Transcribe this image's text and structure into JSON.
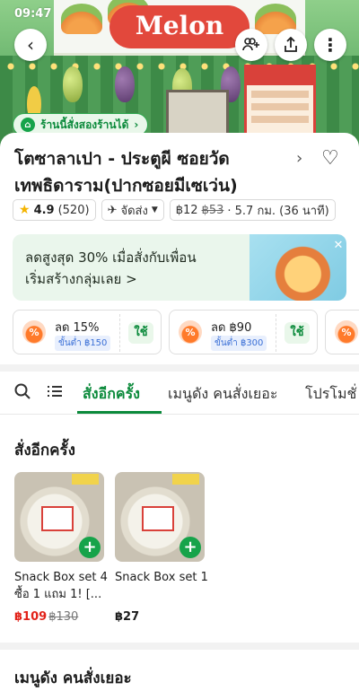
{
  "status_bar": {
    "time": "09:47"
  },
  "banner": {
    "logo_text": "Melon"
  },
  "tag": {
    "label": "ร้านนี้สั่งสองร้านได้"
  },
  "store": {
    "name": "โตซาลาเปา - ประตูผี ซอยวัดเทพธิดาราม(ปากซอยมีเซเว่น)",
    "rating": "4.9",
    "rating_count": "(520)",
    "delivery_label": "จัดส่ง",
    "price_now": "฿12",
    "price_old": "฿53",
    "distance": "· 5.7 กม. (36 นาที)"
  },
  "promo": {
    "line1": "ลดสูงสุด 30% เมื่อสั่งกับเพื่อน",
    "line2": "เริ่มสร้างกลุ่มเลย >"
  },
  "coupons": [
    {
      "title": "ลด 15%",
      "min": "ขั้นต่ำ ฿150",
      "use": "ใช้"
    },
    {
      "title": "ลด ฿90",
      "min": "ขั้นต่ำ ฿300",
      "use": "ใช้"
    }
  ],
  "tabs": [
    "สั่งอีกครั้ง",
    "เมนูดัง คนสั่งเยอะ",
    "โปรโมชั่"
  ],
  "sections": {
    "reorder": "สั่งอีกครั้ง",
    "popular": "เมนูดัง คนสั่งเยอะ"
  },
  "items": [
    {
      "name": "Snack Box set 4 ซื้อ 1 แถม 1! [...",
      "price": "฿109",
      "orig": "฿130"
    },
    {
      "name": "Snack Box set 1",
      "price": "฿27",
      "orig": ""
    }
  ],
  "colors": {
    "brand_green": "#0b8a3b",
    "discount_red": "#e2231a"
  }
}
